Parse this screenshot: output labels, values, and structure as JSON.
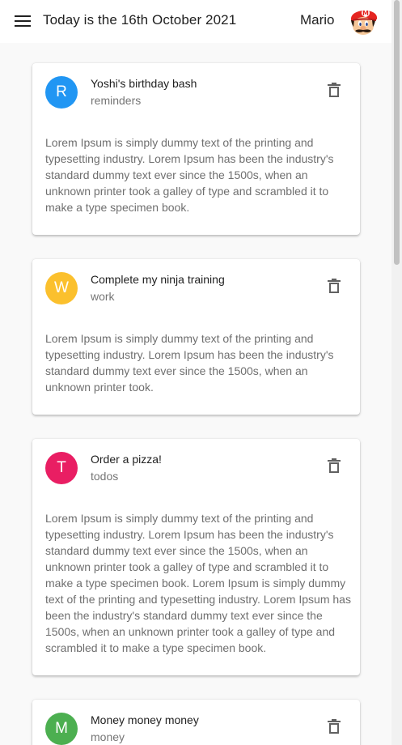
{
  "header": {
    "title": "Today is the 16th October 2021",
    "username": "Mario",
    "menu_icon": "menu-icon",
    "avatar": "mario-avatar"
  },
  "notes": [
    {
      "initial": "R",
      "title": "Yoshi's birthday bash",
      "category": "reminders",
      "color": "#2196f3",
      "body": "Lorem Ipsum is simply dummy text of the printing and typesetting industry. Lorem Ipsum has been the industry's standard dummy text ever since the 1500s, when an unknown printer took a galley of type and scrambled it to make a type specimen book."
    },
    {
      "initial": "W",
      "title": "Complete my ninja training",
      "category": "work",
      "color": "#fbc02d",
      "body": "Lorem Ipsum is simply dummy text of the printing and typesetting industry. Lorem Ipsum has been the industry's standard dummy text ever since the 1500s, when an unknown printer took."
    },
    {
      "initial": "T",
      "title": "Order a pizza!",
      "category": "todos",
      "color": "#e91e63",
      "body": "Lorem Ipsum is simply dummy text of the printing and typesetting industry. Lorem Ipsum has been the industry's standard dummy text ever since the 1500s, when an unknown printer took a galley of type and scrambled it to make a type specimen book. Lorem Ipsum is simply dummy text of the printing and typesetting industry. Lorem Ipsum has been the industry's standard dummy text ever since the 1500s, when an unknown printer took a galley of type and scrambled it to make a type specimen book."
    },
    {
      "initial": "M",
      "title": "Money money money",
      "category": "money",
      "color": "#4caf50",
      "body": ""
    }
  ],
  "icons": {
    "delete": "trash-icon"
  }
}
